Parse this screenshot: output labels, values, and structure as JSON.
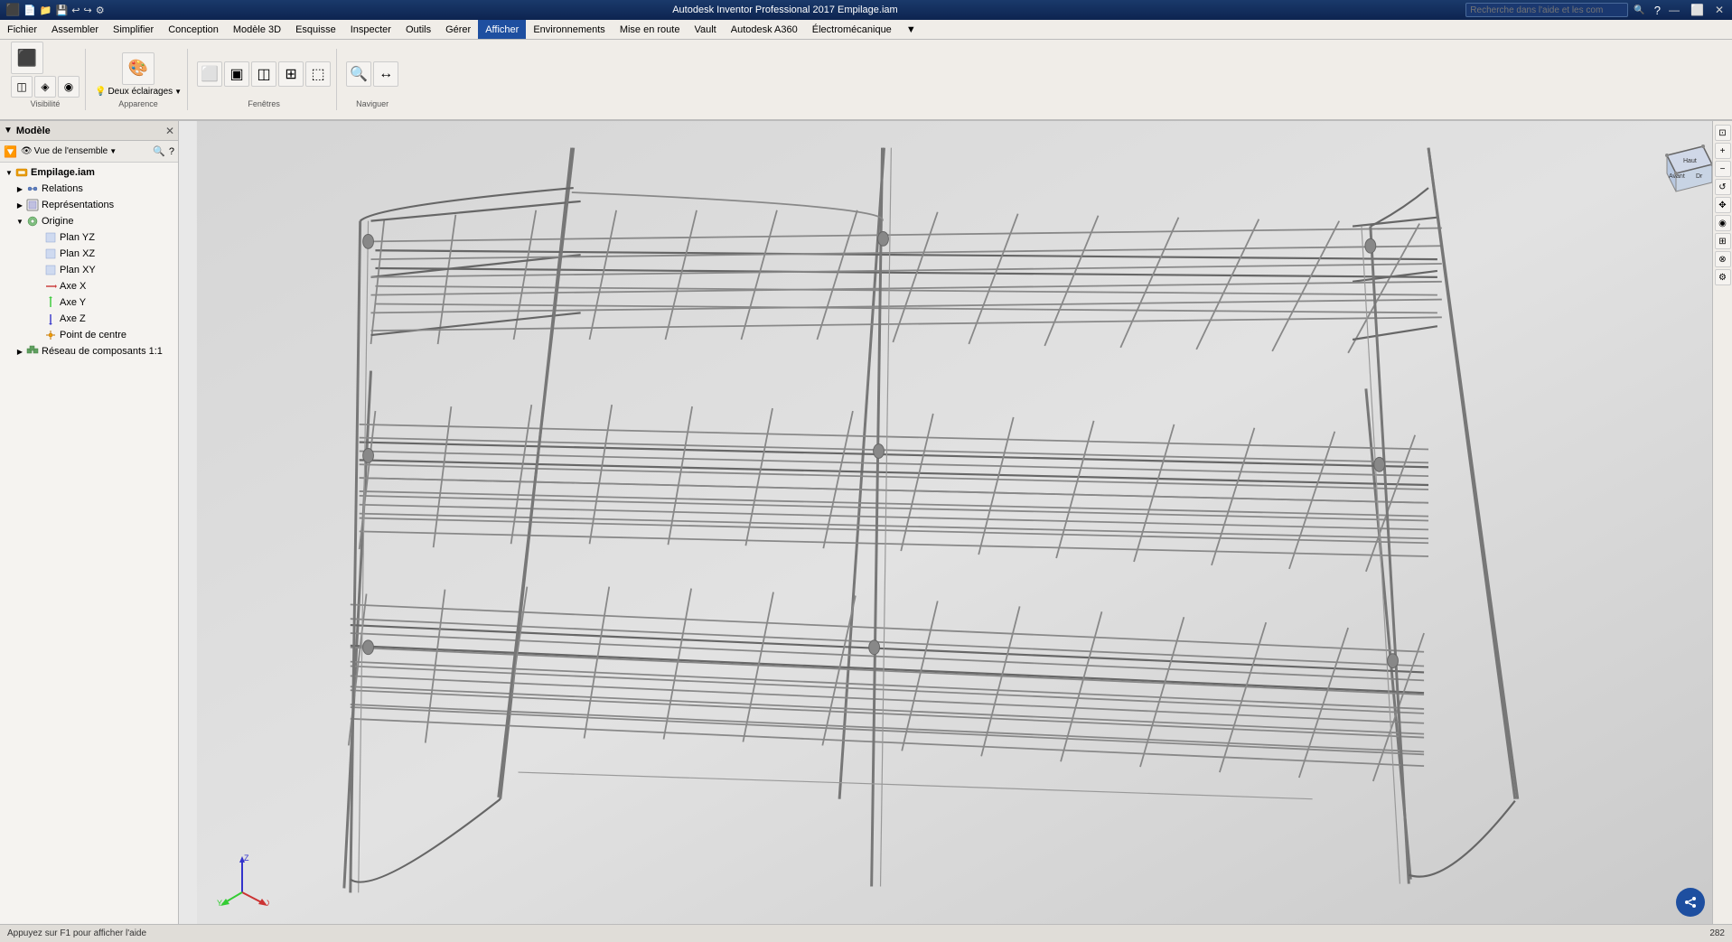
{
  "app": {
    "title": "Autodesk Inventor Professional 2017    Empilage.iam",
    "search_placeholder": "Recherche dans l'aide et les com"
  },
  "titlebar": {
    "left_icons": [
      "⬛",
      "💾",
      "📁",
      "↩",
      "↪"
    ],
    "window_controls": [
      "—",
      "⬜",
      "✕"
    ]
  },
  "menubar": {
    "items": [
      {
        "label": "Fichier",
        "active": false
      },
      {
        "label": "Assembler",
        "active": false
      },
      {
        "label": "Simplifier",
        "active": false
      },
      {
        "label": "Conception",
        "active": false
      },
      {
        "label": "Modèle 3D",
        "active": false
      },
      {
        "label": "Esquisse",
        "active": false
      },
      {
        "label": "Inspecter",
        "active": false
      },
      {
        "label": "Outils",
        "active": false
      },
      {
        "label": "Gérer",
        "active": false
      },
      {
        "label": "Afficher",
        "active": true
      },
      {
        "label": "Environnements",
        "active": false
      },
      {
        "label": "Mise en route",
        "active": false
      },
      {
        "label": "Vault",
        "active": false
      },
      {
        "label": "Autodesk A360",
        "active": false
      },
      {
        "label": "Électromécanique",
        "active": false
      }
    ]
  },
  "ribbon": {
    "groups": [
      {
        "label": "Visibilité",
        "buttons": [
          {
            "icon": "⬛",
            "tooltip": "Visibilité"
          },
          {
            "icon": "◫",
            "tooltip": ""
          },
          {
            "icon": "🔦",
            "tooltip": ""
          },
          {
            "icon": "◈",
            "tooltip": ""
          }
        ]
      },
      {
        "label": "Apparence",
        "buttons": [
          {
            "icon": "🎨",
            "tooltip": "Apparence"
          },
          {
            "icon": "💡",
            "tooltip": "Deux éclairages",
            "has_dropdown": true
          }
        ]
      },
      {
        "label": "Fenêtres",
        "buttons": [
          {
            "icon": "⬜",
            "tooltip": ""
          },
          {
            "icon": "▣",
            "tooltip": ""
          },
          {
            "icon": "◫",
            "tooltip": ""
          },
          {
            "icon": "⊞",
            "tooltip": ""
          },
          {
            "icon": "⬚",
            "tooltip": ""
          }
        ]
      },
      {
        "label": "Naviguer",
        "buttons": [
          {
            "icon": "🔍",
            "tooltip": ""
          },
          {
            "icon": "↔",
            "tooltip": ""
          }
        ]
      }
    ]
  },
  "panel": {
    "title": "Modèle",
    "view_selector": "Vue de l'ensemble",
    "tree": [
      {
        "id": "empilage",
        "label": "Empilage.iam",
        "level": 0,
        "expanded": true,
        "icon": "assembly"
      },
      {
        "id": "relations",
        "label": "Relations",
        "level": 1,
        "expanded": false,
        "icon": "relations"
      },
      {
        "id": "representations",
        "label": "Représentations",
        "level": 1,
        "expanded": false,
        "icon": "representations"
      },
      {
        "id": "origine",
        "label": "Origine",
        "level": 1,
        "expanded": true,
        "icon": "origine"
      },
      {
        "id": "plan-yz",
        "label": "Plan YZ",
        "level": 2,
        "expanded": false,
        "icon": "plan"
      },
      {
        "id": "plan-xz",
        "label": "Plan XZ",
        "level": 2,
        "expanded": false,
        "icon": "plan"
      },
      {
        "id": "plan-xy",
        "label": "Plan XY",
        "level": 2,
        "expanded": false,
        "icon": "plan"
      },
      {
        "id": "axe-x",
        "label": "Axe X",
        "level": 2,
        "expanded": false,
        "icon": "axe"
      },
      {
        "id": "axe-y",
        "label": "Axe Y",
        "level": 2,
        "expanded": false,
        "icon": "axe"
      },
      {
        "id": "axe-z",
        "label": "Axe Z",
        "level": 2,
        "expanded": false,
        "icon": "axe"
      },
      {
        "id": "point-centre",
        "label": "Point de centre",
        "level": 2,
        "expanded": false,
        "icon": "point"
      },
      {
        "id": "reseau",
        "label": "Réseau de composants 1:1",
        "level": 1,
        "expanded": false,
        "icon": "reseau"
      }
    ]
  },
  "viewport": {
    "window_buttons": [
      "—",
      "⬜",
      "✕"
    ],
    "status_zoom": "282",
    "status_text": "Appuyez sur F1 pour afficher l'aide"
  },
  "viewport_controls": [
    {
      "icon": "⊕",
      "tooltip": "Zoom in"
    },
    {
      "icon": "⊖",
      "tooltip": "Zoom out"
    },
    {
      "icon": "⊡",
      "tooltip": "Fit"
    },
    {
      "icon": "↺",
      "tooltip": "Orbit"
    },
    {
      "icon": "⊞",
      "tooltip": "Pan"
    },
    {
      "icon": "👁",
      "tooltip": "Look"
    },
    {
      "icon": "◎",
      "tooltip": ""
    },
    {
      "icon": "⊗",
      "tooltip": ""
    },
    {
      "icon": "◈",
      "tooltip": ""
    },
    {
      "icon": "⊜",
      "tooltip": ""
    }
  ],
  "navcube": {
    "label": "Haut",
    "front": "Avant",
    "right": "Droite"
  },
  "statusbar": {
    "help_text": "Appuyez sur F1 pour afficher l'aide",
    "zoom_label": "282"
  }
}
